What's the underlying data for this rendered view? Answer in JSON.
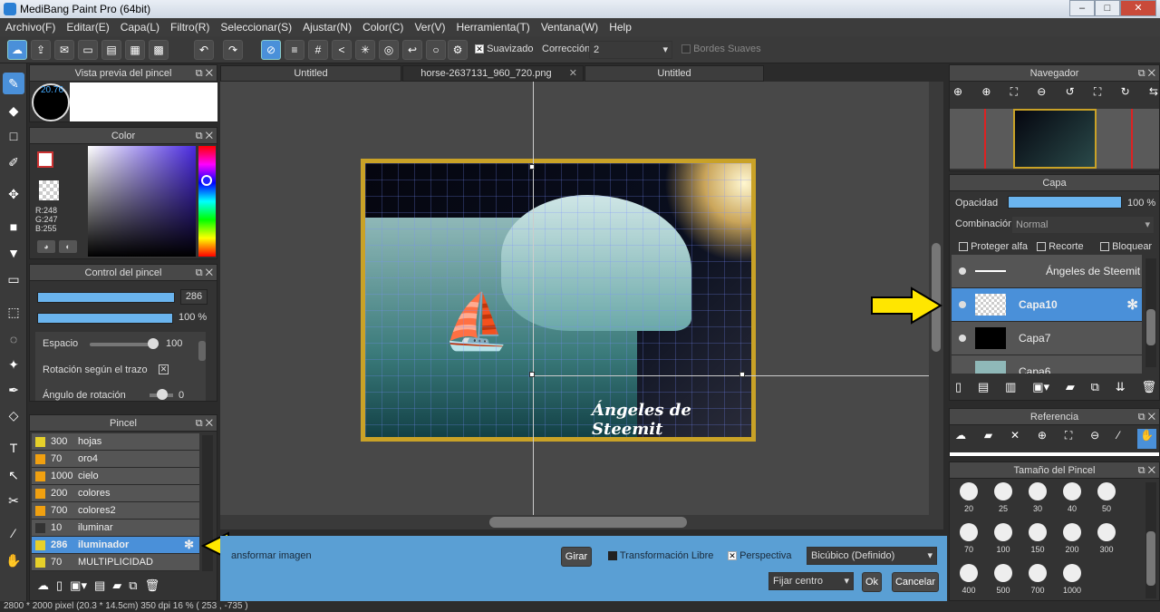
{
  "window": {
    "title": "MediBang Paint Pro (64bit)"
  },
  "menu": [
    "Archivo(F)",
    "Editar(E)",
    "Capa(L)",
    "Filtro(R)",
    "Seleccionar(S)",
    "Ajustar(N)",
    "Color(C)",
    "Ver(V)",
    "Herramienta(T)",
    "Ventana(W)",
    "Help"
  ],
  "toolbar": {
    "smooth_label": "Suavizado",
    "correction_label": "Corrección",
    "correction_value": "2",
    "soft_edges_label": "Bordes Suaves"
  },
  "brush_preview": {
    "title": "Vista previa del pincel",
    "size": "20.76"
  },
  "color_panel": {
    "title": "Color",
    "r": "R:248",
    "g": "G:247",
    "b": "B:255"
  },
  "brush_control": {
    "title": "Control del pincel",
    "size_value": "286",
    "opacity_value": "100 %",
    "spacing_label": "Espacio",
    "spacing_value": "100",
    "rotation_follow_label": "Rotación según el trazo",
    "rotation_angle_label": "Ángulo de rotación",
    "rotation_angle_value": "0"
  },
  "brush_list": {
    "title": "Pincel",
    "items": [
      {
        "size": "300",
        "name": "hojas",
        "color": "#e6d02a"
      },
      {
        "size": "70",
        "name": "oro4",
        "color": "#f0a010"
      },
      {
        "size": "1000",
        "name": "cielo",
        "color": "#f0a010"
      },
      {
        "size": "200",
        "name": "colores",
        "color": "#f0a010"
      },
      {
        "size": "700",
        "name": "colores2",
        "color": "#f0a010"
      },
      {
        "size": "10",
        "name": "iluminar",
        "color": "#333333"
      },
      {
        "size": "286",
        "name": "iluminador",
        "color": "#e6d02a"
      },
      {
        "size": "70",
        "name": "MULTIPLICIDAD",
        "color": "#e6d02a"
      }
    ]
  },
  "tabs": [
    "Untitled",
    "horse-2637131_960_720.png",
    "Untitled"
  ],
  "artwork": {
    "signature": "Ángeles de Steemit"
  },
  "transform": {
    "label": "ansformar imagen",
    "rotate": "Girar",
    "free_label": "Transformación Libre",
    "perspective_label": "Perspectiva",
    "interp": "Bicúbico (Definido)",
    "anchor": "Fijar centro",
    "ok": "Ok",
    "cancel": "Cancelar"
  },
  "status": "2800 * 2000 pixel   (20.3 * 14.5cm)   350 dpi   16 %   (  253 , -735 )",
  "navigator": {
    "title": "Navegador"
  },
  "layers": {
    "title": "Capa",
    "opacity_label": "Opacidad",
    "opacity_value": "100 %",
    "blend_label": "Combinación",
    "blend_value": "Normal",
    "protect_alpha": "Proteger alfa",
    "clip": "Recorte",
    "lock": "Bloquear",
    "items": [
      {
        "name": "Ángeles de Steemit"
      },
      {
        "name": "Capa10"
      },
      {
        "name": "Capa7"
      },
      {
        "name": "Capa6"
      }
    ]
  },
  "reference": {
    "title": "Referencia"
  },
  "brush_size": {
    "title": "Tamaño del Pincel",
    "sizes": [
      "20",
      "25",
      "30",
      "40",
      "50",
      "70",
      "100",
      "150",
      "200",
      "300",
      "400",
      "500",
      "700",
      "1000"
    ]
  }
}
